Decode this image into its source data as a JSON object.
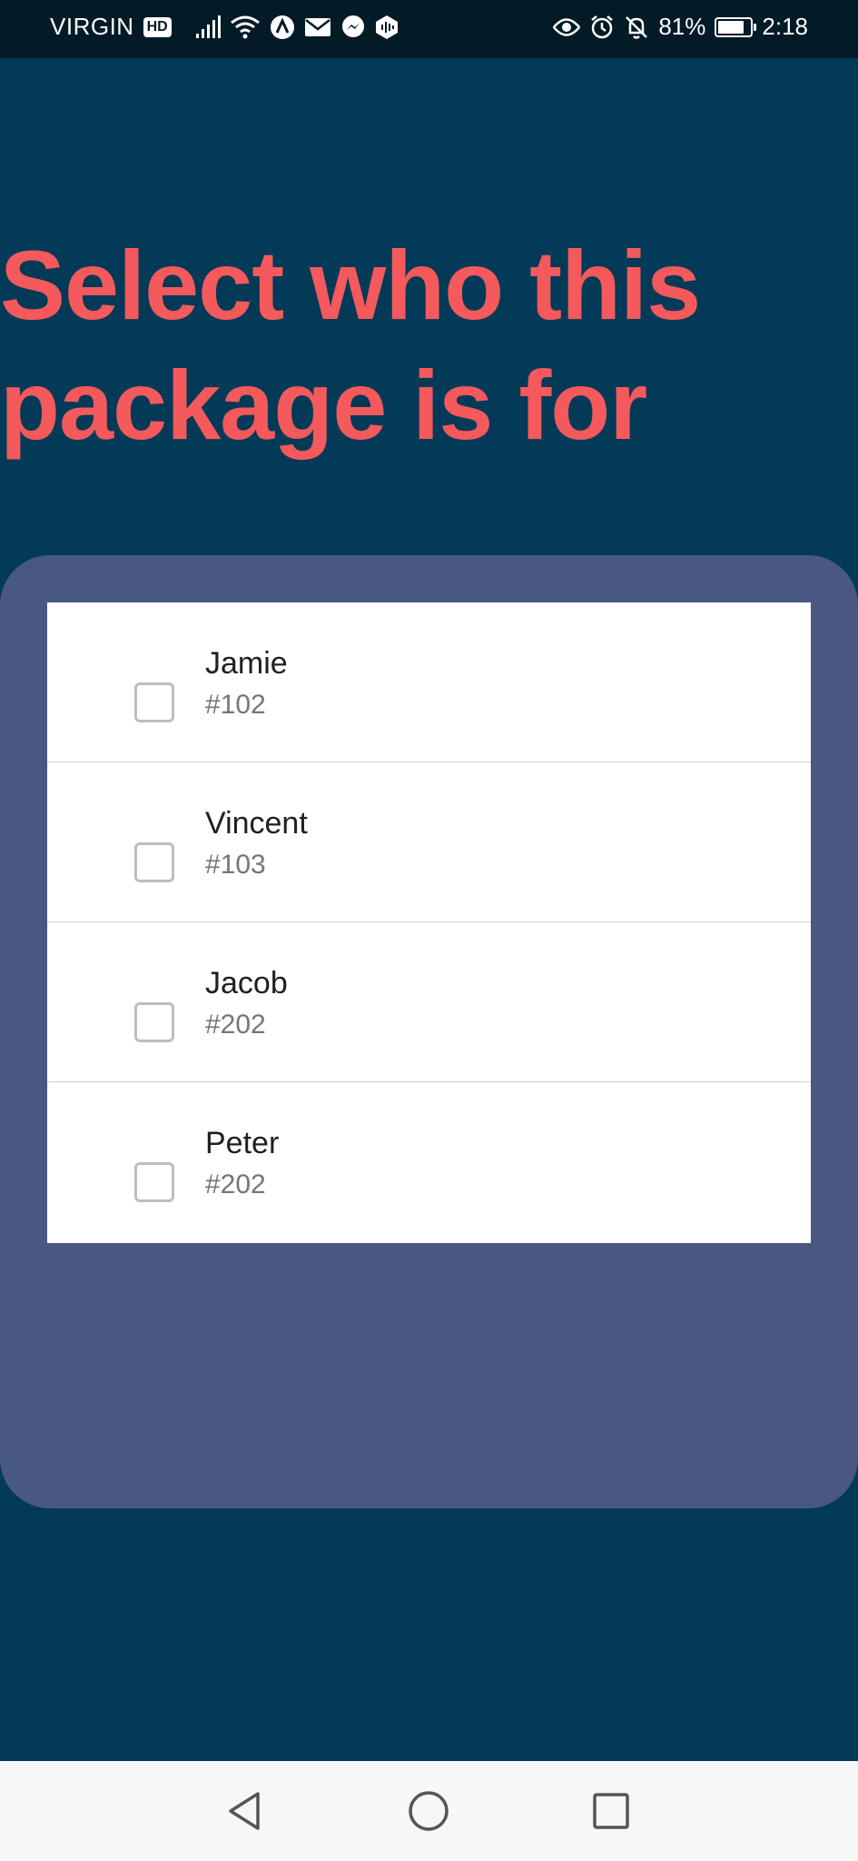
{
  "status_bar": {
    "carrier": "VIRGIN",
    "hd_badge": "HD",
    "battery_percent": "81%",
    "battery_level": 0.81,
    "time": "2:18",
    "icons": [
      "signal-icon",
      "wifi-icon",
      "app-a-icon",
      "mail-icon",
      "messenger-icon",
      "podcast-icon",
      "eye-icon",
      "alarm-icon",
      "mute-bell-icon",
      "battery-icon"
    ]
  },
  "page": {
    "title": "Select who this package is for"
  },
  "recipients": [
    {
      "name": "Jamie",
      "unit": "#102",
      "checked": false
    },
    {
      "name": "Vincent",
      "unit": "#103",
      "checked": false
    },
    {
      "name": "Jacob",
      "unit": "#202",
      "checked": false
    },
    {
      "name": "Peter",
      "unit": "#202",
      "checked": false
    }
  ],
  "nav_bar": {
    "icons": [
      "back-icon",
      "home-icon",
      "recents-icon"
    ]
  },
  "colors": {
    "background": "#023a58",
    "status_bar": "#031a27",
    "title": "#f4595c",
    "card": "#485882",
    "list_background": "#ffffff",
    "nav_bar": "#f7f7f7"
  }
}
